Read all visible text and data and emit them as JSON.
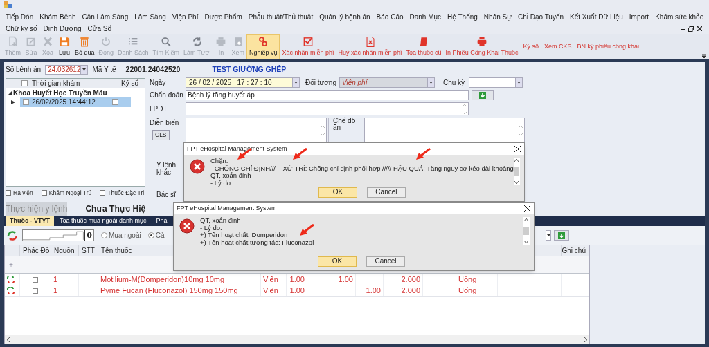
{
  "menu_rows": [
    [
      "Tiếp Đón",
      "Khám Bệnh",
      "Cận Lâm Sàng",
      "Lâm Sàng",
      "Viện Phí",
      "Dược Phẩm",
      "Phẫu thuật/Thủ thuật",
      "Quản lý bệnh án",
      "Báo Cáo",
      "Danh Mục",
      "Hệ Thống",
      "Nhân Sự",
      "Chỉ Đạo Tuyến",
      "Kết Xuất Dữ Liệu",
      "Import",
      "Khám sức khỏe"
    ],
    [
      "Chữ ký số",
      "Dinh Dưỡng",
      "Cửa Sổ"
    ]
  ],
  "toolbar": [
    {
      "label": "Thêm",
      "kind": "icon",
      "disabled": true,
      "selected": false,
      "accent": false
    },
    {
      "label": "Sửa",
      "kind": "icon",
      "disabled": true,
      "selected": false,
      "accent": false
    },
    {
      "label": "Xóa",
      "kind": "icon",
      "disabled": true,
      "selected": false,
      "accent": false
    },
    {
      "label": "Lưu",
      "kind": "icon",
      "disabled": false,
      "selected": false,
      "accent": false
    },
    {
      "label": "Bỏ qua",
      "kind": "icon",
      "disabled": false,
      "selected": false,
      "accent": false
    },
    {
      "label": "Đóng",
      "kind": "icon",
      "disabled": true,
      "selected": false,
      "accent": false
    },
    {
      "label": "Danh Sách",
      "kind": "icon",
      "disabled": true,
      "selected": false,
      "accent": false
    },
    {
      "label": "Tìm Kiếm",
      "kind": "icon",
      "disabled": true,
      "selected": false,
      "accent": false
    },
    {
      "label": "Làm Tươi",
      "kind": "icon",
      "disabled": true,
      "selected": false,
      "accent": false
    },
    {
      "label": "In",
      "kind": "icon",
      "disabled": true,
      "selected": false,
      "accent": false
    },
    {
      "label": "Xem",
      "kind": "icon",
      "disabled": true,
      "selected": false,
      "accent": false
    },
    {
      "label": "Nghiệp vụ",
      "kind": "icon",
      "disabled": false,
      "selected": true,
      "accent": false
    },
    {
      "label": "Xác nhận miễn phí",
      "kind": "icon",
      "disabled": false,
      "selected": false,
      "accent": true
    },
    {
      "label": "Huỷ xác nhận miễn phí",
      "kind": "icon",
      "disabled": false,
      "selected": false,
      "accent": true
    },
    {
      "label": "Toa thuốc cũ",
      "kind": "icon",
      "disabled": false,
      "selected": false,
      "accent": true
    },
    {
      "label": "In Phiếu Công Khai Thuốc",
      "kind": "icon",
      "disabled": false,
      "selected": false,
      "accent": true
    },
    {
      "label": "Ký số",
      "kind": "text",
      "disabled": false,
      "selected": false,
      "accent": true
    },
    {
      "label": "Xem CKS",
      "kind": "text",
      "disabled": false,
      "selected": false,
      "accent": true
    },
    {
      "label": "BN ký phiếu công khai",
      "kind": "text",
      "disabled": false,
      "selected": false,
      "accent": true
    }
  ],
  "patient": {
    "record_label": "Số bệnh án",
    "record_value": "24.032612",
    "health_id_label": "Mã Y tế",
    "health_id": "22001.24042520",
    "bed_note": "TEST GIƯỜNG GHÉP"
  },
  "visits": {
    "columns": [
      "Thời gian khám",
      "Ký số"
    ],
    "header_checked": false,
    "groups": [
      {
        "name": "Khoa Huyết Học Truyền Máu",
        "expanded": true,
        "children": [
          {
            "time": "26/02/2025 14:44:12",
            "checked": false,
            "signed": false,
            "selected": true
          }
        ]
      }
    ]
  },
  "options": [
    {
      "label": "Ra viện",
      "checked": false
    },
    {
      "label": "Khám Ngoại Trú",
      "checked": false
    },
    {
      "label": "Thuốc Đặc Trị",
      "checked": false
    }
  ],
  "execute_button": {
    "label": "Thực hiện y lệnh",
    "disabled": true
  },
  "status_text": "Chưa Thực Hiệ",
  "form": {
    "date_label": "Ngày",
    "date_value": "26 / 02 / 2025   17 : 27 : 10",
    "object_label": "Đối tượng",
    "object_value": "Viện phí",
    "cycle_label": "Chu kỳ",
    "diagnosis_label": "Chẩn đoán",
    "diagnosis_value": "Bệnh lý tăng huyết áp",
    "lpdt_label": "LPDT",
    "progress_label": "Diễn biến",
    "cls_button": "CLS",
    "diet_label": "Chế độ ăn",
    "other_orders_label": "Y lệnh khác",
    "doctor_label": "Bác sĩ"
  },
  "dialogs": [
    {
      "title": "FPT eHospital Management System",
      "lines": [
        "Chặn:",
        "- CHỐNG CHỈ ĐỊNH///    XỬ TRÍ: Chống chỉ định phối hợp ///// HẬU QUẢ: Tăng nguy cơ kéo dài khoảng",
        "QT, xoắn đỉnh",
        "- Lý do:"
      ],
      "buttons": [
        {
          "label": "OK",
          "selected": true
        },
        {
          "label": "Cancel",
          "selected": false
        }
      ]
    },
    {
      "title": "FPT eHospital Management System",
      "lines": [
        "QT, xoắn đỉnh",
        "- Lý do:",
        "+) Tên hoạt chất: Domperidon",
        "+) Tên hoạt chất tương tác: Fluconazol"
      ],
      "buttons": [
        {
          "label": "OK",
          "selected": true
        },
        {
          "label": "Cancel",
          "selected": false
        }
      ]
    }
  ],
  "tabs": [
    {
      "label": "Thuốc - VTYT",
      "selected": true
    },
    {
      "label": "Toa thuốc mua ngoài danh mục",
      "selected": false
    },
    {
      "label": "Phá",
      "selected": false
    }
  ],
  "quantity_value": "0",
  "radios": [
    {
      "label": "Mua ngoài",
      "selected": false
    },
    {
      "label": "Cả",
      "selected": true
    }
  ],
  "table": {
    "headers": {
      "phac_do": "Phác Đồ",
      "nguon": "Nguồn",
      "stt": "STT",
      "ten_thuoc": "Tên thuốc",
      "ghi_chu": "Ghi chú"
    },
    "rows": [
      {
        "checked": false,
        "nguon": "1",
        "ten_thuoc": "Motilium-M(Domperidon)10mg 10mg",
        "column_6": "Viên",
        "column_7": "1.00",
        "column_8": "1.00",
        "column_10": "2.000",
        "column_12": "Uống"
      },
      {
        "checked": false,
        "nguon": "1",
        "ten_thuoc": "Pyme Fucan (Fluconazol) 150mg 150mg",
        "column_6": "Viên",
        "column_7": "1.00",
        "column_9": "1.00",
        "column_10": "2.000",
        "column_12": "Uống"
      }
    ]
  }
}
